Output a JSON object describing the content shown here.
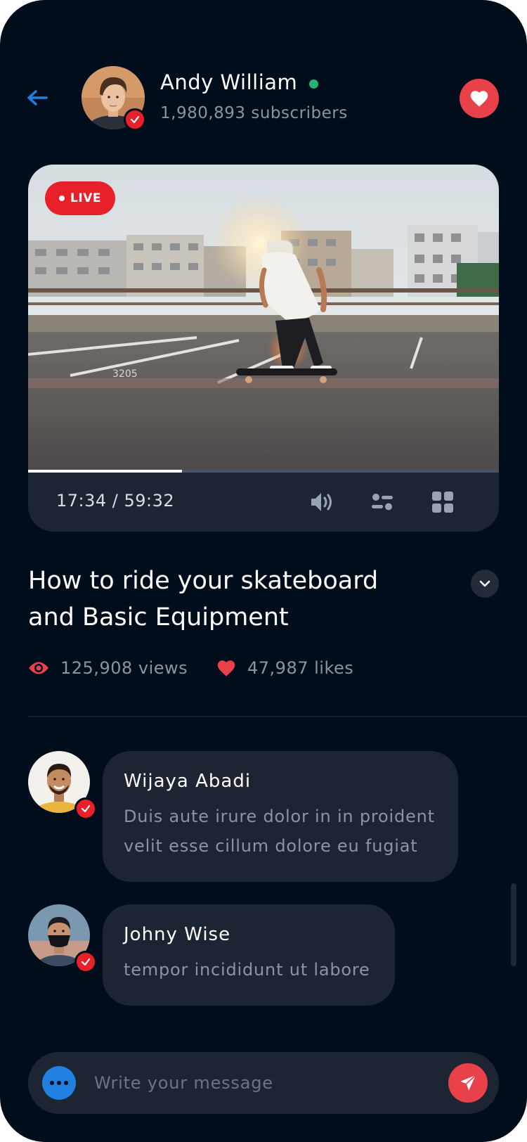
{
  "header": {
    "host_name": "Andy William",
    "subscribers": "1,980,893 subscribers"
  },
  "player": {
    "live_label": "LIVE",
    "time": "17:34 / 59:32",
    "progress": 0.327
  },
  "video": {
    "title": "How to ride your skateboard and Basic Equipment",
    "views": "125,908 views",
    "likes": "47,987 likes"
  },
  "comments": [
    {
      "name": "Wijaya Abadi",
      "text": "Duis aute irure dolor in in proident velit esse cillum dolore eu fugiat"
    },
    {
      "name": "Johny Wise",
      "text": "tempor incididunt ut labore"
    }
  ],
  "composer": {
    "placeholder": "Write your message"
  },
  "colors": {
    "background": "#020d1c",
    "surface": "#1d2533",
    "accent_red": "#e8414a",
    "live_red": "#e8202a",
    "accent_blue": "#1f80e0",
    "online_green": "#22b573",
    "muted_text": "#8a94a6"
  },
  "icons": [
    "back-arrow-icon",
    "verified-icon",
    "heart-icon",
    "volume-icon",
    "settings-icon",
    "grid-icon",
    "chevron-down-icon",
    "eye-icon",
    "more-icon",
    "send-icon"
  ]
}
